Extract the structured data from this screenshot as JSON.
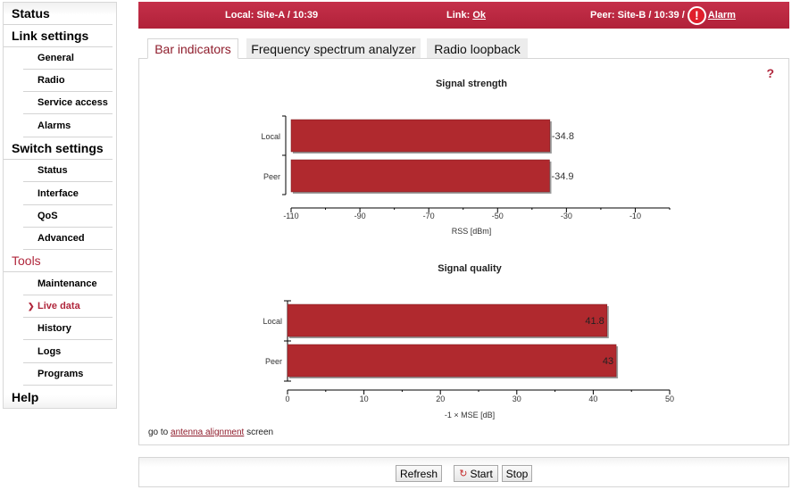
{
  "sidebar": {
    "items": [
      {
        "label": "Status",
        "level": "top"
      },
      {
        "label": "Link settings",
        "level": "top"
      },
      {
        "label": "General",
        "level": "sub"
      },
      {
        "label": "Radio",
        "level": "sub"
      },
      {
        "label": "Service access",
        "level": "sub"
      },
      {
        "label": "Alarms",
        "level": "sub"
      },
      {
        "label": "Switch settings",
        "level": "top"
      },
      {
        "label": "Status",
        "level": "sub"
      },
      {
        "label": "Interface",
        "level": "sub"
      },
      {
        "label": "QoS",
        "level": "sub"
      },
      {
        "label": "Advanced",
        "level": "sub"
      },
      {
        "label": "Tools",
        "level": "top",
        "highlight": true
      },
      {
        "label": "Maintenance",
        "level": "sub"
      },
      {
        "label": "Live data",
        "level": "sub",
        "active": true
      },
      {
        "label": "History",
        "level": "sub"
      },
      {
        "label": "Logs",
        "level": "sub"
      },
      {
        "label": "Programs",
        "level": "sub"
      },
      {
        "label": "Help",
        "level": "top"
      }
    ],
    "active_marker": "›"
  },
  "header": {
    "local": "Local: Site-A / 10:39",
    "link_label": "Link: ",
    "link_value": "Ok",
    "peer": "Peer: Site-B / 10:39 /",
    "alarm_icon": "!",
    "alarm_label": "Alarm"
  },
  "tabs": [
    {
      "label": "Bar indicators",
      "active": true
    },
    {
      "label": "Frequency spectrum analyzer",
      "active": false
    },
    {
      "label": "Radio loopback",
      "active": false
    }
  ],
  "help_label": "?",
  "footnote": {
    "prefix": "go to ",
    "link": "antenna alignment",
    "suffix": " screen"
  },
  "toolbar": {
    "refresh": "Refresh",
    "start": "Start",
    "stop": "Stop",
    "start_icon": "↻"
  },
  "colors": {
    "accent": "#b0273c",
    "bar": "#b0292e"
  },
  "chart_data": [
    {
      "type": "bar",
      "orientation": "horizontal",
      "title": "Signal strength",
      "categories": [
        "Local",
        "Peer"
      ],
      "values": [
        -34.8,
        -34.9
      ],
      "value_labels": [
        "-34.8",
        "-34.9"
      ],
      "label_position": "outside",
      "xlabel": "RSS [dBm]",
      "xlim": [
        -110,
        0
      ],
      "xticks": [
        -110,
        -90,
        -70,
        -50,
        -30,
        -10
      ],
      "grid": false
    },
    {
      "type": "bar",
      "orientation": "horizontal",
      "title": "Signal quality",
      "categories": [
        "Local",
        "Peer"
      ],
      "values": [
        41.8,
        43
      ],
      "value_labels": [
        "41.8",
        "43"
      ],
      "label_position": "inside",
      "xlabel": "-1 × MSE [dB]",
      "xlim": [
        0,
        50
      ],
      "xticks": [
        0,
        10,
        20,
        30,
        40,
        50
      ],
      "grid": false
    }
  ]
}
